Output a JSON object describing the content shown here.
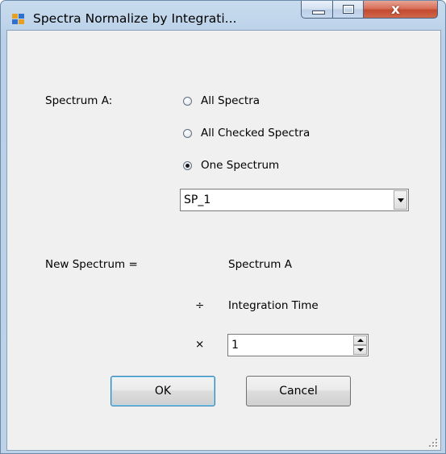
{
  "window": {
    "title": "Spectra Normalize by Integrati...",
    "close_label": "x"
  },
  "form": {
    "spectrum_a_label": "Spectrum A:",
    "options": [
      {
        "label": "All Spectra",
        "checked": false
      },
      {
        "label": "All Checked Spectra",
        "checked": false
      },
      {
        "label": "One Spectrum",
        "checked": true
      }
    ],
    "spectrum_select_value": "SP_1",
    "new_spectrum_label": "New Spectrum =",
    "formula_term": "Spectrum A",
    "divide_symbol": "÷",
    "divide_term": "Integration Time",
    "multiply_symbol": "×",
    "multiplier_value": "1"
  },
  "buttons": {
    "ok": "OK",
    "cancel": "Cancel"
  },
  "icons": {
    "app": "app-icon",
    "minimize": "minimize-icon",
    "maximize": "maximize-icon",
    "close": "close-icon",
    "dropdown": "chevron-down-icon",
    "spin_up": "spin-up-icon",
    "spin_down": "spin-down-icon",
    "resize": "resize-grip-icon"
  },
  "colors": {
    "titlebar": "#bcd2e9",
    "client": "#f0f0f0",
    "close_button": "#c24a2f",
    "default_button_border": "#3c7fb1"
  }
}
